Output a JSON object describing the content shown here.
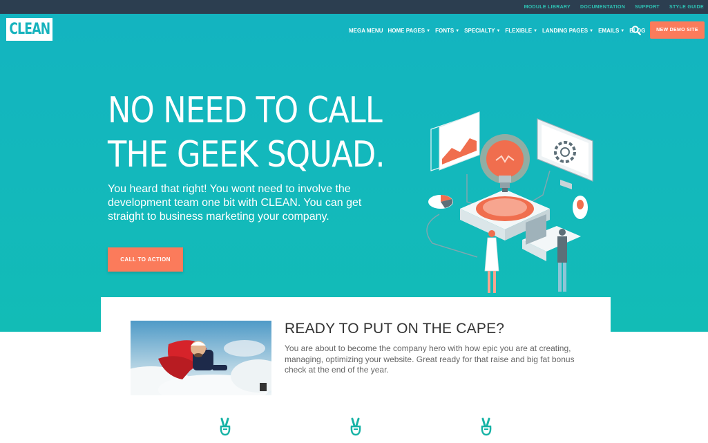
{
  "topbar": {
    "links": [
      "MODULE LIBRARY",
      "DOCUMENTATION",
      "SUPPORT",
      "STYLE GUIDE"
    ]
  },
  "logo": {
    "text": "CLEAN"
  },
  "nav": {
    "items": [
      {
        "label": "MEGA MENU",
        "dropdown": false
      },
      {
        "label": "HOME PAGES",
        "dropdown": true
      },
      {
        "label": "FONTS",
        "dropdown": true
      },
      {
        "label": "SPECIALTY",
        "dropdown": true
      },
      {
        "label": "FLEXIBLE",
        "dropdown": true
      },
      {
        "label": "LANDING PAGES",
        "dropdown": true
      },
      {
        "label": "EMAILS",
        "dropdown": true
      },
      {
        "label": "BLOG",
        "dropdown": false
      }
    ],
    "demo_button": "NEW DEMO SITE"
  },
  "hero": {
    "headline_line1": "NO NEED TO CALL",
    "headline_line2": "THE GEEK SQUAD.",
    "subtext": "You heard that right! You wont need to involve the development team one bit with CLEAN. You can get straight to business marketing your company.",
    "cta": "CALL TO ACTION"
  },
  "feature": {
    "title": "READY TO PUT ON THE CAPE?",
    "text": "You are about to become the company hero with how epic you are at creating, managing, optimizing your website.  Great ready for that raise and big fat bonus check at the end of the year."
  },
  "colors": {
    "topbar": "#2c3e50",
    "teal": "#13b6bd",
    "accent": "#fb7b5b",
    "link": "#2ec4b6"
  },
  "icons": [
    "search-icon",
    "chevron-down-icon",
    "peace-hand-icon"
  ]
}
